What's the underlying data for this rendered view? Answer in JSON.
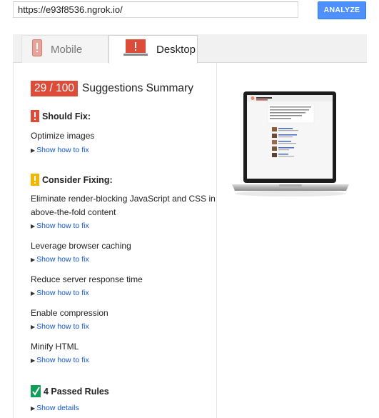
{
  "search": {
    "url_value": "https://e93f8536.ngrok.io/"
  },
  "toolbar": {
    "analyze_label": "ANALYZE"
  },
  "tabs": [
    {
      "label": "Mobile",
      "icon": "phone-warning-icon",
      "active": false
    },
    {
      "label": "Desktop",
      "icon": "monitor-warning-icon",
      "active": true
    }
  ],
  "summary": {
    "score": "29 / 100",
    "title": "Suggestions Summary",
    "score_color": "#dd4b39"
  },
  "should_fix": {
    "heading": "Should Fix:",
    "color": "#dd4b39",
    "items": [
      {
        "title": "Optimize images",
        "link": "Show how to fix"
      }
    ]
  },
  "consider_fixing": {
    "heading": "Consider Fixing:",
    "color": "#f4b400",
    "items": [
      {
        "title": "Eliminate render-blocking JavaScript and CSS in above-the-fold content",
        "link": "Show how to fix"
      },
      {
        "title": "Leverage browser caching",
        "link": "Show how to fix"
      },
      {
        "title": "Reduce server response time",
        "link": "Show how to fix"
      },
      {
        "title": "Enable compression",
        "link": "Show how to fix"
      },
      {
        "title": "Minify HTML",
        "link": "Show how to fix"
      }
    ]
  },
  "passed": {
    "heading": "4 Passed Rules",
    "color": "#0f9d58",
    "link": "Show details"
  }
}
